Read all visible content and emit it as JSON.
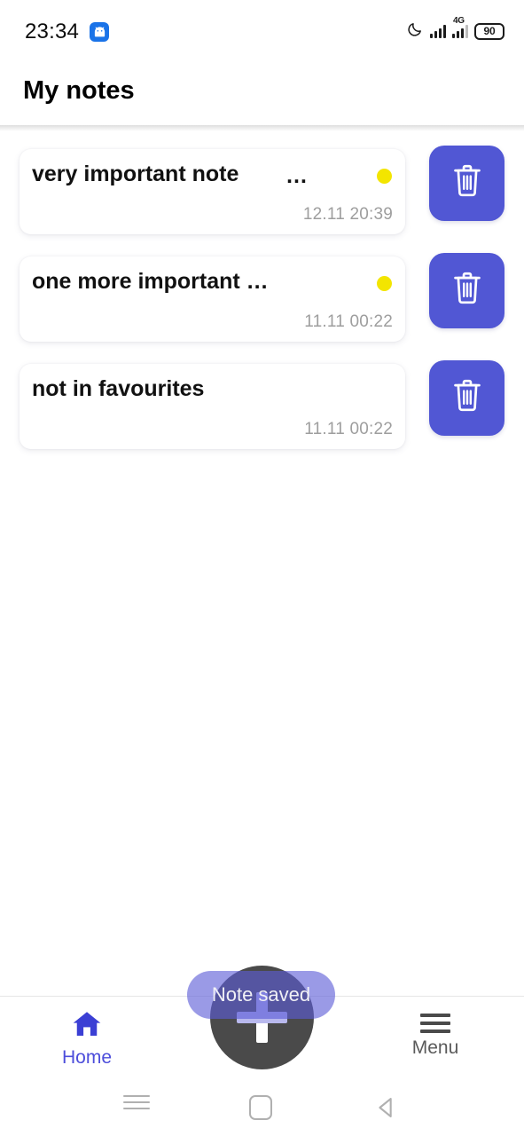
{
  "status_bar": {
    "time": "23:34",
    "app_icon": "android-robot-icon",
    "dnd_icon": "crescent-moon-icon",
    "signal_icon": "signal-bars-icon",
    "network_label": "4G",
    "battery_level": "90"
  },
  "app_bar": {
    "title": "My notes"
  },
  "notes": [
    {
      "title": "very important note",
      "overflow": "…",
      "timestamp": "12.11 20:39",
      "favourite": true,
      "delete_icon": "trash-icon"
    },
    {
      "title": "one more important …",
      "overflow": "",
      "timestamp": "11.11 00:22",
      "favourite": true,
      "delete_icon": "trash-icon"
    },
    {
      "title": "not in favourites",
      "overflow": "",
      "timestamp": "11.11 00:22",
      "favourite": false,
      "delete_icon": "trash-icon"
    }
  ],
  "toast": {
    "message": "Note saved"
  },
  "fab": {
    "icon": "plus-icon"
  },
  "bottom_nav": [
    {
      "label": "Home",
      "icon": "home-icon",
      "active": true
    },
    {
      "label": "Menu",
      "icon": "hamburger-icon",
      "active": false
    }
  ],
  "system_nav": {
    "recents": "recents-icon",
    "home": "home-square-icon",
    "back": "back-triangle-icon"
  },
  "colors": {
    "accent": "#5157D4",
    "home_active": "#4c4ddb",
    "favourite_dot": "#F3E500",
    "fab_background": "#4a4a4a",
    "timestamp": "#9e9e9e"
  }
}
